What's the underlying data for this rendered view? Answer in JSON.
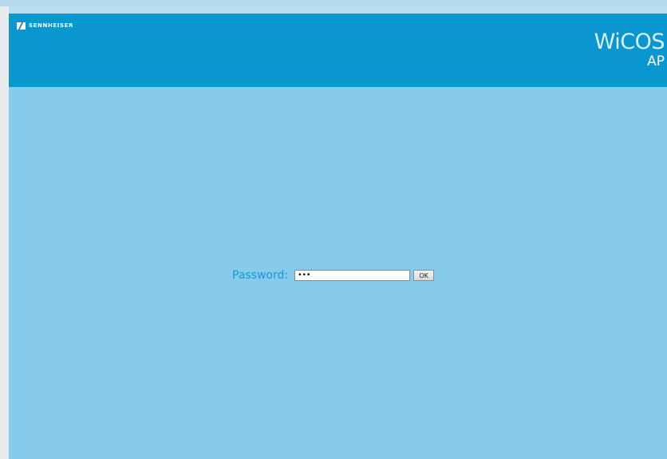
{
  "header": {
    "logo_text": "SENNHEISER",
    "brand_name": "WiCOS",
    "brand_subtitle": "AP"
  },
  "login": {
    "password_label": "Password:",
    "password_value": "•••",
    "ok_label": "OK"
  },
  "colors": {
    "header_blue": "#0a96cf",
    "content_blue": "#86cbeb",
    "label_blue": "#1798d4"
  }
}
